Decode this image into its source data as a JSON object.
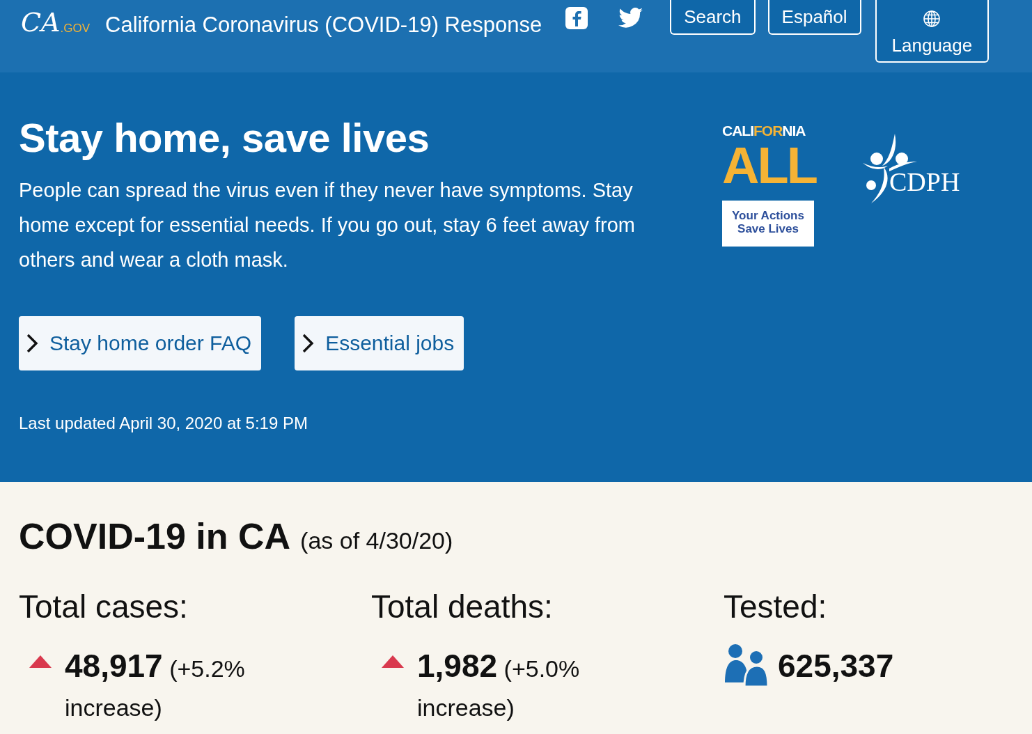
{
  "header": {
    "logo": {
      "script": "CA",
      "suffix": ".GOV"
    },
    "title": "California Coronavirus (COVID-19) Response",
    "social": [
      {
        "kind": "facebook"
      },
      {
        "kind": "twitter"
      }
    ],
    "buttons": [
      {
        "label": "Search",
        "kind": "plain"
      },
      {
        "label": "Español",
        "kind": "plain"
      },
      {
        "label": "Language",
        "kind": "globe"
      }
    ]
  },
  "hero": {
    "heading": "Stay home, save lives",
    "text": "People can spread the virus even if they never have symptoms. Stay home except for essential needs. If you go out, stay 6 feet away from others and wear a cloth mask.",
    "links": [
      {
        "label": "Stay home order FAQ"
      },
      {
        "label": "Essential jobs"
      }
    ],
    "updated": "Last updated April 30, 2020 at 5:19 PM",
    "california_all": {
      "word": [
        "CALI",
        "FOR",
        "NIA"
      ],
      "big": "ALL",
      "tagline": "Your Actions Save Lives"
    },
    "cdph": {
      "text": "CDPH"
    }
  },
  "stats": {
    "heading": "COVID-19 in CA",
    "asof": "(as of 4/30/20)",
    "items": [
      {
        "label": "Total cases:",
        "kind": "increase",
        "value": "**48,917** (+5.2% increase)"
      },
      {
        "label": "Total deaths:",
        "kind": "increase",
        "value": "**1,982** (+5.0% increase)"
      },
      {
        "label": "Tested:",
        "kind": "people",
        "value": "**625,337**"
      }
    ]
  }
}
